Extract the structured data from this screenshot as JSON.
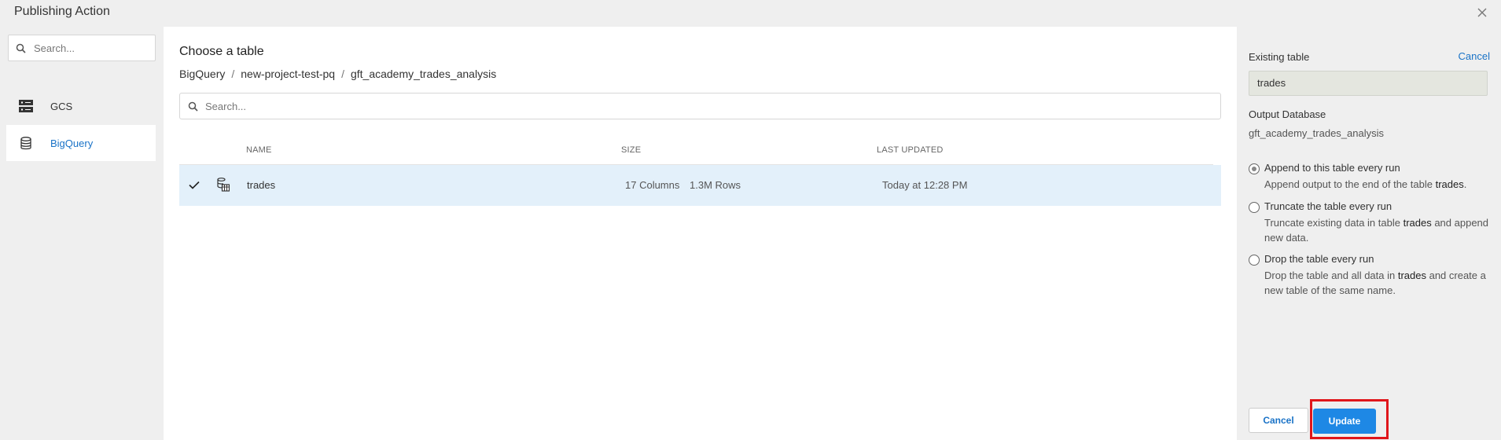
{
  "window": {
    "title": "Publishing Action",
    "close_icon": "close-icon"
  },
  "sidebar": {
    "search_placeholder": "Search...",
    "items": [
      {
        "label": "GCS",
        "icon": "storage-server-icon",
        "active": false
      },
      {
        "label": "BigQuery",
        "icon": "database-icon",
        "active": true
      }
    ]
  },
  "main": {
    "heading": "Choose a table",
    "breadcrumb": [
      "BigQuery",
      "new-project-test-pq",
      "gft_academy_trades_analysis"
    ],
    "breadcrumb_separator": "/",
    "search_placeholder": "Search...",
    "columns": {
      "name": "NAME",
      "size": "SIZE",
      "updated": "LAST UPDATED"
    },
    "rows": [
      {
        "selected": true,
        "name": "trades",
        "columns": "17 Columns",
        "rows": "1.3M Rows",
        "updated": "Today at 12:28 PM"
      }
    ]
  },
  "right_panel": {
    "existing_label": "Existing table",
    "cancel_link": "Cancel",
    "table_value": "trades",
    "output_db_label": "Output Database",
    "output_db_value": "gft_academy_trades_analysis",
    "options": [
      {
        "title": "Append to this table every run",
        "desc_pre": "Append output to the end of the table ",
        "desc_bold": "trades",
        "desc_post": ".",
        "checked": true
      },
      {
        "title": "Truncate the table every run",
        "desc_pre": "Truncate existing data in table ",
        "desc_bold": "trades",
        "desc_post": " and append new data.",
        "checked": false
      },
      {
        "title": "Drop the table every run",
        "desc_pre": "Drop the table and all data in ",
        "desc_bold": "trades",
        "desc_post": " and create a new table of the same name.",
        "checked": false
      }
    ],
    "cancel_button": "Cancel",
    "update_button": "Update"
  },
  "colors": {
    "accent": "#1e88e5",
    "link": "#1a73c7",
    "selected_row": "#e3f0fa",
    "highlight": "#e0161b"
  }
}
